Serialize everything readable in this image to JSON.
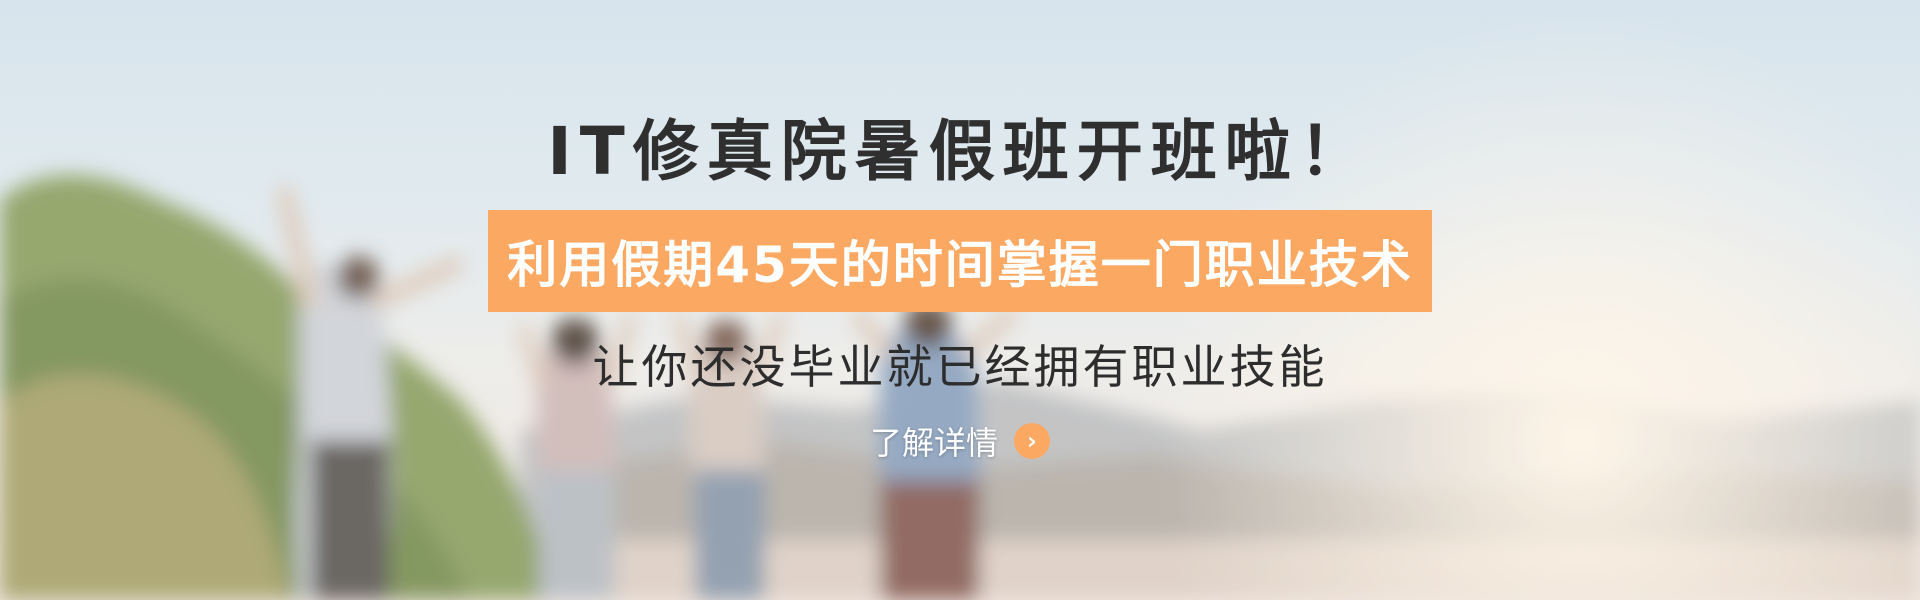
{
  "banner": {
    "title": "IT修真院暑假班开班啦！",
    "highlight": "利用假期45天的时间掌握一门职业技术",
    "subtitle": "让你还没毕业就已经拥有职业技能",
    "cta_label": "了解详情",
    "cta_icon": "chevron-right-icon",
    "accent_color": "#fba862",
    "title_color": "#2f2f2f"
  }
}
